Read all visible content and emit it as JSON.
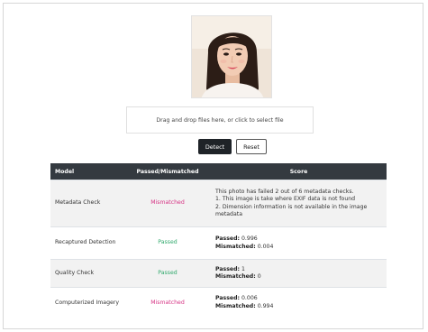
{
  "upload": {
    "dropzone_text": "Drag and drop files here, or click to select file",
    "detect_label": "Detect",
    "reset_label": "Reset"
  },
  "table": {
    "headers": {
      "model": "Model",
      "status": "Passed/Mismatched",
      "score": "Score"
    },
    "rows": [
      {
        "model": "Metadata Check",
        "status": "Mismatched",
        "summary": "This photo has failed 2 out of 6 metadata checks.",
        "details": [
          "1. This image is take where EXIF data is not found",
          "2. Dimension information is not available in the image metadata"
        ]
      },
      {
        "model": "Recaptured Detection",
        "status": "Passed",
        "passed_label": "Passed:",
        "passed_value": "0.996",
        "mismatched_label": "Mismatched:",
        "mismatched_value": "0.004"
      },
      {
        "model": "Quality Check",
        "status": "Passed",
        "passed_label": "Passed:",
        "passed_value": "1",
        "mismatched_label": "Mismatched:",
        "mismatched_value": "0"
      },
      {
        "model": "Computerized Imagery",
        "status": "Mismatched",
        "passed_label": "Passed:",
        "passed_value": "0.006",
        "mismatched_label": "Mismatched:",
        "mismatched_value": "0.994"
      }
    ]
  },
  "colors": {
    "header_bg": "#343a40",
    "mismatched": "#d63384",
    "passed": "#2fa86b"
  }
}
